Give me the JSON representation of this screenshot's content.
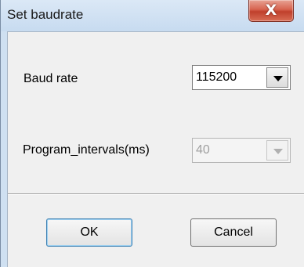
{
  "window": {
    "title": "Set baudrate",
    "close_glyph": "X"
  },
  "form": {
    "baud_rate": {
      "label": "Baud rate",
      "value": "115200"
    },
    "program_intervals": {
      "label": "Program_intervals(ms)",
      "value": "40",
      "enabled": false
    }
  },
  "buttons": {
    "ok_label": "OK",
    "cancel_label": "Cancel"
  }
}
